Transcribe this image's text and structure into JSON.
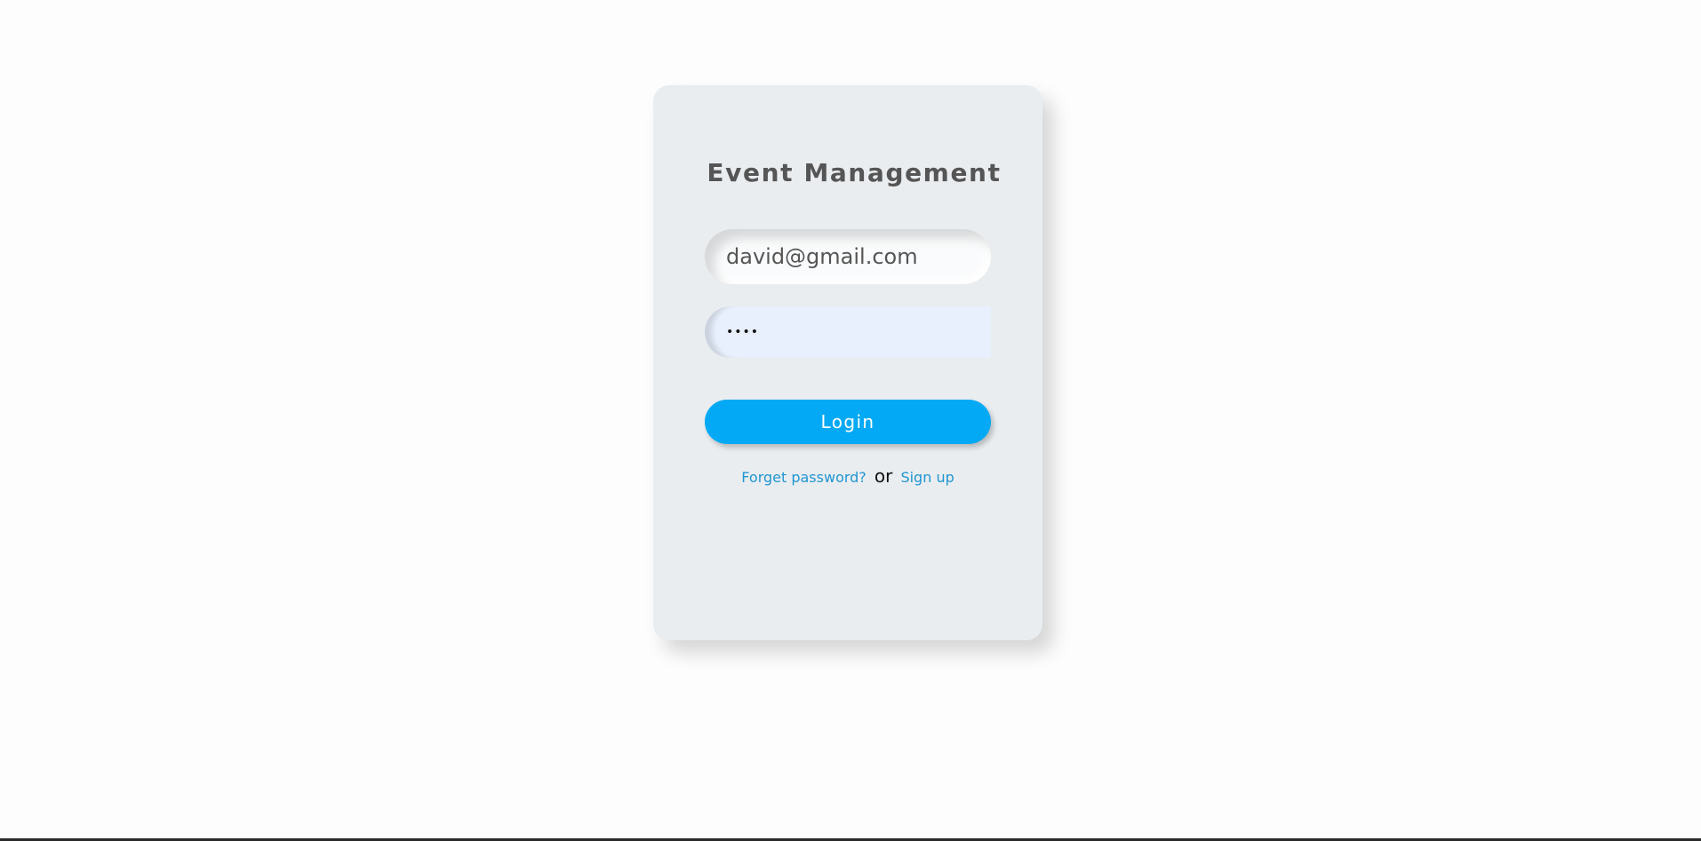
{
  "card": {
    "title": "Event Management"
  },
  "form": {
    "email_value": "david@gmail.com",
    "password_mask": "••••",
    "login_label": "Login"
  },
  "links": {
    "forgot_label": "Forget password?",
    "or_label": "or",
    "signup_label": "Sign up"
  },
  "colors": {
    "accent": "#03a9f4",
    "link": "#2196d3",
    "card_bg": "#eaedf0",
    "page_bg": "#fdfdfd"
  }
}
